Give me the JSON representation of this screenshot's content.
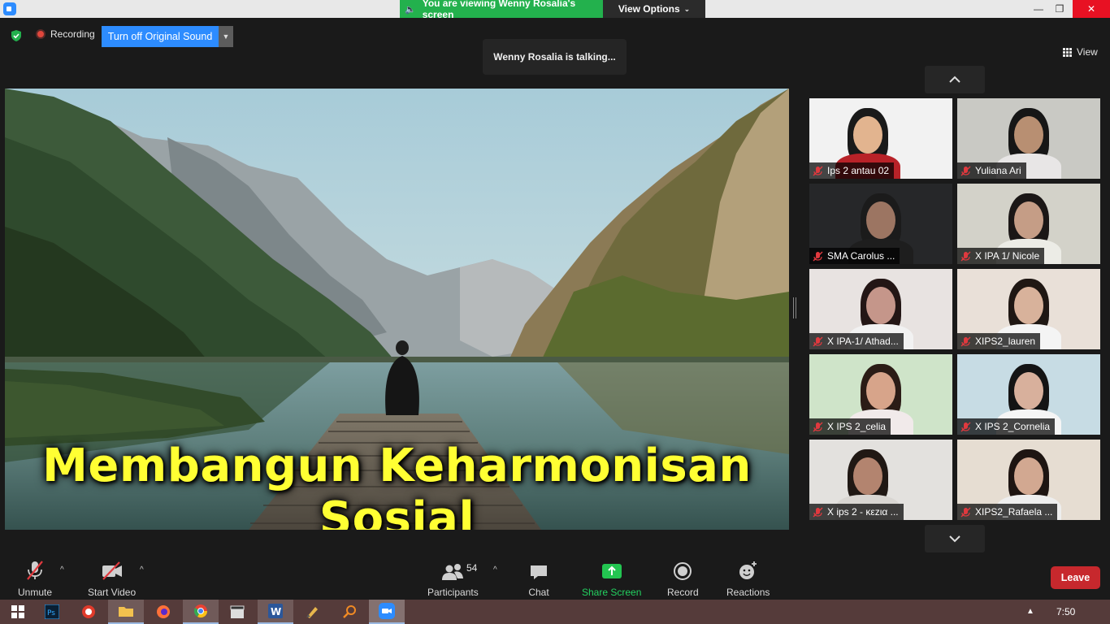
{
  "titlebar": {
    "viewing_text": "You are viewing Wenny Rosalia's screen",
    "view_options_label": "View Options",
    "minimize_glyph": "—",
    "maximize_glyph": "❐",
    "close_glyph": "✕"
  },
  "topbar": {
    "recording_label": "Recording",
    "original_sound_label": "Turn off Original Sound",
    "talking_text": "Wenny Rosalia is talking...",
    "view_label": "View"
  },
  "shared_screen": {
    "slide_title": "Membangun Keharmonisan Sosial"
  },
  "gallery": {
    "participants": [
      {
        "name": "Ips 2 antau 02",
        "bg": "#f2f2f2",
        "skin": "#e2b48f",
        "shirt": "#b82228",
        "hair": "#1a1a1a"
      },
      {
        "name": "Yuliana Ari",
        "bg": "#c9c9c4",
        "skin": "#b88f72",
        "shirt": "#e8e6e6",
        "hair": "#161616"
      },
      {
        "name": "SMA Carolus ...",
        "bg": "#262729",
        "skin": "#9c7562",
        "shirt": "#1e1e1e",
        "hair": "#1b1b1b"
      },
      {
        "name": "X IPA 1/ Nicole",
        "bg": "#d3d2c9",
        "skin": "#c59d86",
        "shirt": "#ecece6",
        "hair": "#1b1716"
      },
      {
        "name": "X IPA-1/ Athad...",
        "bg": "#e8e3e1",
        "skin": "#c5968a",
        "shirt": "#f2f2f2",
        "hair": "#231615"
      },
      {
        "name": "XIPS2_lauren",
        "bg": "#e9e0d8",
        "skin": "#d8b29b",
        "shirt": "#f4f4f4",
        "hair": "#1f1713"
      },
      {
        "name": "X IPS 2_celia",
        "bg": "#cfe4c9",
        "skin": "#d7a48a",
        "shirt": "#f1eaea",
        "hair": "#2b1c16"
      },
      {
        "name": "X IPS 2_Cornelia",
        "bg": "#c7dce4",
        "skin": "#d8b09c",
        "shirt": "#f5f5f5",
        "hair": "#141414"
      },
      {
        "name": "X ips 2 - κεzια ...",
        "bg": "#e3e1de",
        "skin": "#b3846f",
        "shirt": "#d9d6d2",
        "hair": "#201814"
      },
      {
        "name": "XIPS2_Rafaela ...",
        "bg": "#e6ddd2",
        "skin": "#d2a891",
        "shirt": "#eeeeee",
        "hair": "#1e1512"
      }
    ]
  },
  "toolbar": {
    "unmute_label": "Unmute",
    "start_video_label": "Start Video",
    "participants_label": "Participants",
    "participants_count": "54",
    "chat_label": "Chat",
    "share_screen_label": "Share Screen",
    "record_label": "Record",
    "reactions_label": "Reactions",
    "leave_label": "Leave"
  },
  "taskbar": {
    "clock": "7:50",
    "apps": [
      "windows-start",
      "photoshop",
      "snagit",
      "file-explorer",
      "firefox",
      "chrome",
      "video-editor",
      "word",
      "sketch-app",
      "search-app",
      "zoom"
    ],
    "active_app": "zoom"
  },
  "colors": {
    "accent_blue": "#2d8cff",
    "banner_green": "#23b14d",
    "leave_red": "#c7282d",
    "slide_title_yellow": "#ffff33",
    "taskbar_bg": "#553b3a"
  }
}
